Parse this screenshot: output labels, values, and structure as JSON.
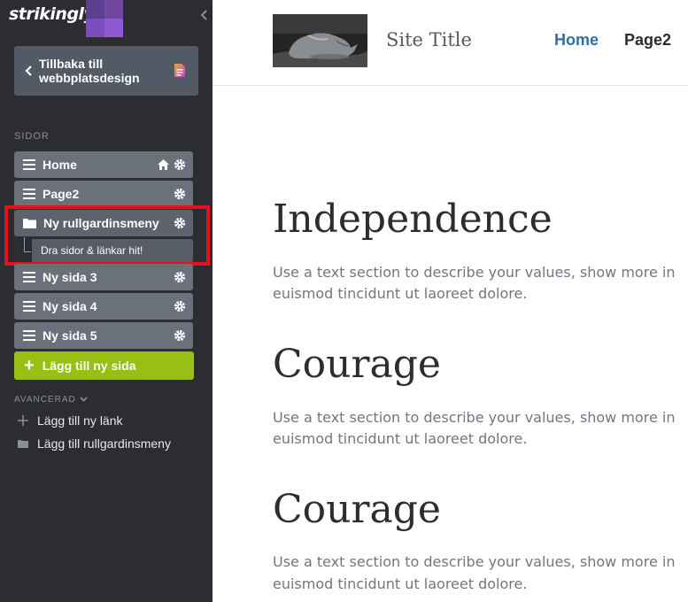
{
  "sidebar": {
    "brand": "strikingly",
    "back_label": "Tillbaka till webbplatsdesign",
    "pages_title": "SIDOR",
    "pages": [
      {
        "label": "Home"
      },
      {
        "label": "Page2"
      },
      {
        "label": "Ny rullgardinsmeny"
      },
      {
        "label": "Ny sida 3"
      },
      {
        "label": "Ny sida 4"
      },
      {
        "label": "Ny sida 5"
      }
    ],
    "drop_hint": "Dra sidor & länkar hit!",
    "add_page": "Lägg till ny sida",
    "advanced_title": "AVANCERAD",
    "advanced_links": [
      {
        "label": "Lägg till ny länk",
        "icon": "plus-icon"
      },
      {
        "label": "Lägg till rullgardinsmeny",
        "icon": "folder-icon"
      }
    ]
  },
  "site": {
    "title": "Site Title",
    "nav": [
      {
        "label": "Home"
      },
      {
        "label": "Page2"
      }
    ],
    "sections": [
      {
        "heading": "Independence",
        "line1": "Use a text section to describe your values, show more in",
        "line2": "euismod tincidunt ut laoreet dolore."
      },
      {
        "heading": "Courage",
        "line1": "Use a text section to describe your values, show more in",
        "line2": "euismod tincidunt ut laoreet dolore."
      },
      {
        "heading": "Courage",
        "line1": "Use a text section to describe your values, show more in",
        "line2": "euismod tincidunt ut laoreet dolore."
      }
    ]
  },
  "colors": {
    "sidebar_bg": "#2b2d30",
    "accent_green": "#97bf14",
    "brand_purple": "#8e59d1",
    "nav_active": "#2e6eaa",
    "highlight_red": "#e8101a"
  }
}
